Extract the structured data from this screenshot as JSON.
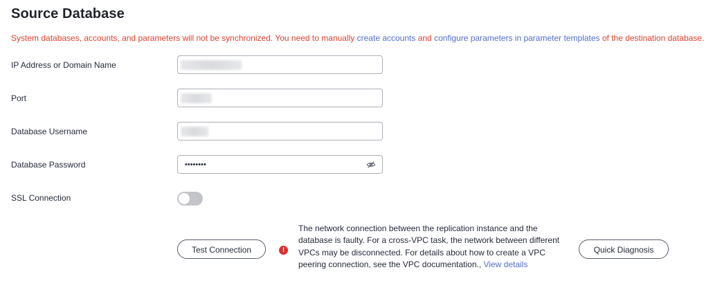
{
  "section": {
    "title": "Source Database"
  },
  "notice": {
    "prefix": "System databases, accounts, and parameters will not be synchronized. You need to manually ",
    "link1": "create accounts",
    "middle": " and ",
    "link2": "configure parameters in parameter templates",
    "suffix": " of the destination database."
  },
  "fields": {
    "ip_label": "IP Address or Domain Name",
    "port_label": "Port",
    "username_label": "Database Username",
    "password_label": "Database Password",
    "password_mask": "••••••••",
    "ssl_label": "SSL Connection",
    "ssl_enabled": false
  },
  "actions": {
    "test_label": "Test Connection",
    "diagnosis_label": "Quick Diagnosis"
  },
  "error": {
    "icon_glyph": "!",
    "message": "The network connection between the replication instance and the database is faulty. For a cross-VPC task, the network between different VPCs may be disconnected. For details about how to create a VPC peering connection, see the VPC documentation., ",
    "link": "View details"
  },
  "colors": {
    "error": "#e03e2d",
    "link": "#526ecc",
    "toggle_off": "#c2c4c9"
  }
}
